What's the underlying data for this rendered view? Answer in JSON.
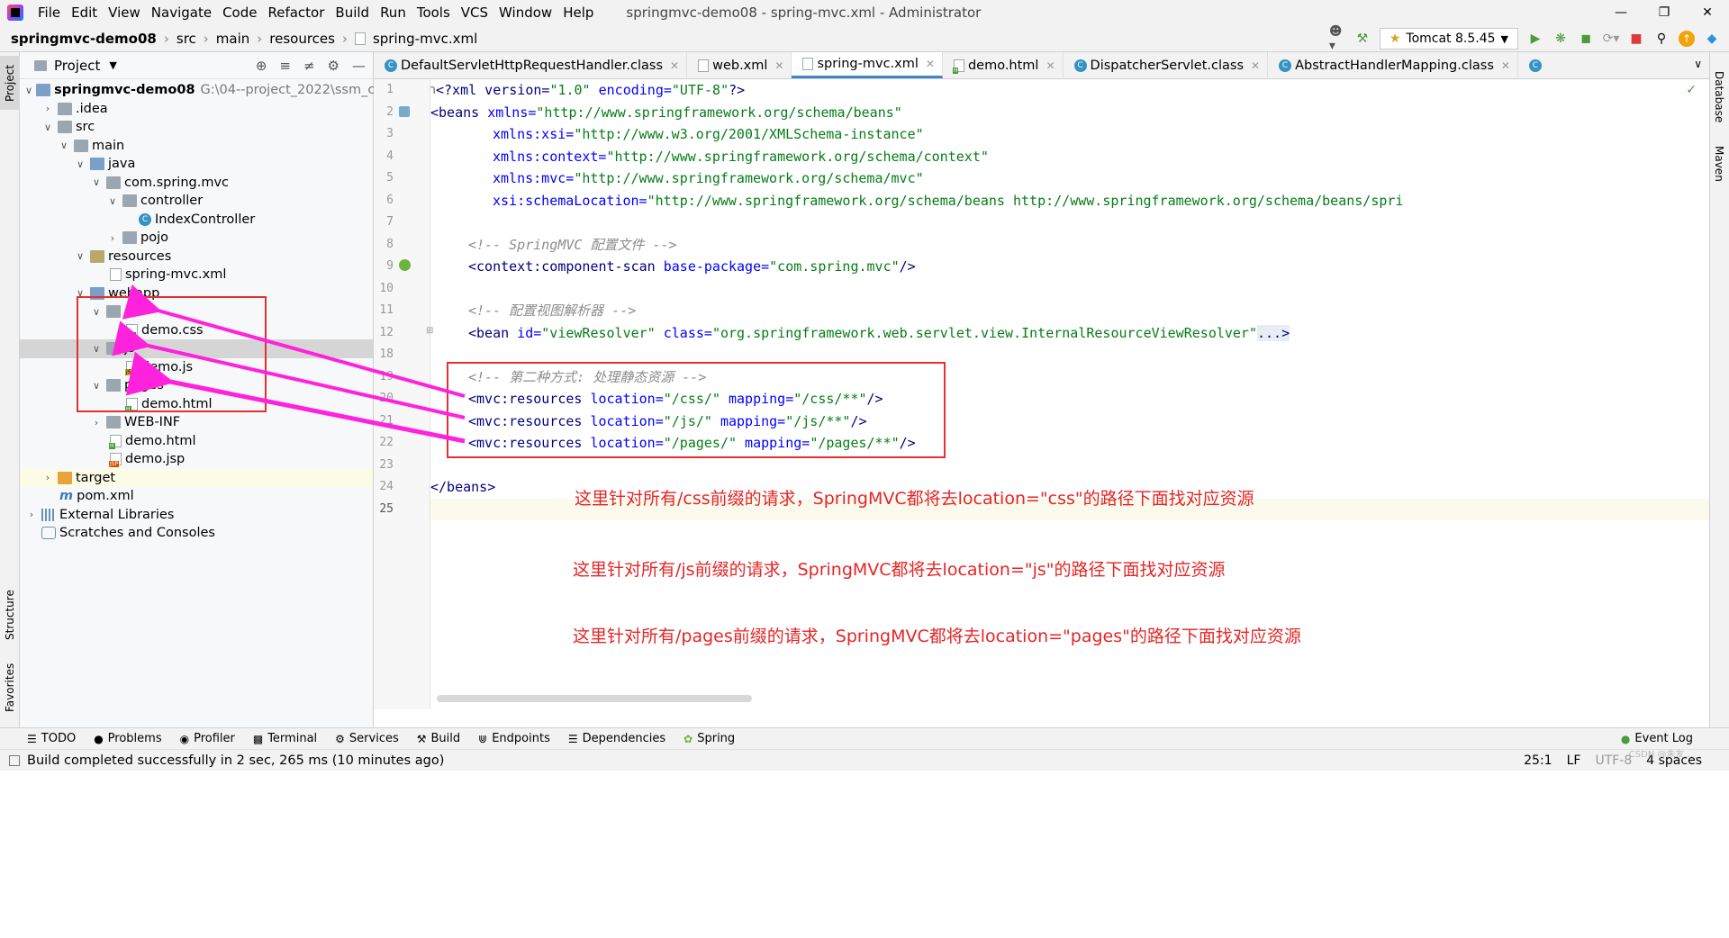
{
  "menubar": {
    "items": [
      "File",
      "Edit",
      "View",
      "Navigate",
      "Code",
      "Refactor",
      "Build",
      "Run",
      "Tools",
      "VCS",
      "Window",
      "Help"
    ],
    "window_title": "springmvc-demo08 - spring-mvc.xml - Administrator"
  },
  "navbar": {
    "crumbs": [
      "springmvc-demo08",
      "src",
      "main",
      "resources",
      "spring-mvc.xml"
    ],
    "run_config": "Tomcat 8.5.45"
  },
  "left_strip": {
    "project": "Project",
    "structure": "Structure",
    "favorites": "Favorites"
  },
  "right_strip": {
    "database": "Database",
    "maven": "Maven"
  },
  "project_panel": {
    "title": "Project",
    "tree": [
      {
        "label": "springmvc-demo08",
        "path": "G:\\04--project_2022\\ssm_code\\sprin",
        "bold": true
      },
      {
        "label": ".idea"
      },
      {
        "label": "src"
      },
      {
        "label": "main"
      },
      {
        "label": "java"
      },
      {
        "label": "com.spring.mvc"
      },
      {
        "label": "controller"
      },
      {
        "label": "IndexController"
      },
      {
        "label": "pojo"
      },
      {
        "label": "resources"
      },
      {
        "label": "spring-mvc.xml"
      },
      {
        "label": "webapp"
      },
      {
        "label": "css"
      },
      {
        "label": "demo.css"
      },
      {
        "label": "js"
      },
      {
        "label": "demo.js"
      },
      {
        "label": "pages"
      },
      {
        "label": "demo.html"
      },
      {
        "label": "WEB-INF"
      },
      {
        "label": "demo.html"
      },
      {
        "label": "demo.jsp"
      },
      {
        "label": "target"
      },
      {
        "label": "pom.xml"
      },
      {
        "label": "External Libraries"
      },
      {
        "label": "Scratches and Consoles"
      }
    ]
  },
  "editor_tabs": [
    "DefaultServletHttpRequestHandler.class",
    "web.xml",
    "spring-mvc.xml",
    "demo.html",
    "DispatcherServlet.class",
    "AbstractHandlerMapping.class"
  ],
  "line_numbers": [
    "1",
    "2",
    "3",
    "4",
    "5",
    "6",
    "7",
    "8",
    "9",
    "10",
    "11",
    "12",
    "18",
    "19",
    "20",
    "21",
    "22",
    "23",
    "24",
    "25"
  ],
  "code": {
    "l1a": "<?xml version=",
    "l1b": "\"1.0\"",
    "l1c": " encoding=",
    "l1d": "\"UTF-8\"",
    "l1e": "?>",
    "l2a": "<beans",
    " l2b": "",
    "l2attr": " xmlns=",
    "l2val": "\"http://www.springframework.org/schema/beans\"",
    "l3attr": "xmlns:xsi=",
    "l3val": "\"http://www.w3.org/2001/XMLSchema-instance\"",
    "l4attr": "xmlns:context=",
    "l4val": "\"http://www.springframework.org/schema/context\"",
    "l5attr": "xmlns:mvc=",
    "l5val": "\"http://www.springframework.org/schema/mvc\"",
    "l6attr": "xsi:schemaLocation=",
    "l6val": "\"http://www.springframework.org/schema/beans http://www.springframework.org/schema/beans/spri",
    "l8": "<!-- SpringMVC 配置文件 -->",
    "l9tag": "<context:component-scan",
    "l9attr": " base-package=",
    "l9val": "\"com.spring.mvc\"",
    "l9end": "/>",
    "l11": "<!-- 配置视图解析器 -->",
    "l12tag": "<bean",
    "l12attr1": " id=",
    "l12val1": "\"viewResolver\"",
    "l12attr2": " class=",
    "l12val2": "\"org.springframework.web.servlet.view.InternalResourceViewResolver\"",
    "l12end": "...>",
    "l19": "<!-- 第二种方式: 处理静态资源 -->",
    "l20tag": "<mvc:resources",
    "l20attr1": " location=",
    "l20val1": "\"/css/\"",
    "l20attr2": " mapping=",
    "l20val2": "\"/css/**\"",
    "l20end": "/>",
    "l21tag": "<mvc:resources",
    "l21attr1": " location=",
    "l21val1": "\"/js/\"",
    "l21attr2": " mapping=",
    "l21val2": "\"/js/**\"",
    "l21end": "/>",
    "l22tag": "<mvc:resources",
    "l22attr1": " location=",
    "l22val1": "\"/pages/\"",
    "l22attr2": " mapping=",
    "l22val2": "\"/pages/**\"",
    "l22end": "/>",
    "l24": "</beans>"
  },
  "notes": {
    "n1": "这里针对所有/css前缀的请求，SpringMVC都将去location=\"css\"的路径下面找对应资源",
    "n2": "这里针对所有/js前缀的请求，SpringMVC都将去location=\"js\"的路径下面找对应资源",
    "n3": "这里针对所有/pages前缀的请求，SpringMVC都将去location=\"pages\"的路径下面找对应资源"
  },
  "tool_windows": [
    "TODO",
    "Problems",
    "Profiler",
    "Terminal",
    "Services",
    "Build",
    "Endpoints",
    "Dependencies",
    "Spring"
  ],
  "event_log": "Event Log",
  "status": {
    "message": "Build completed successfully in 2 sec, 265 ms (10 minutes ago)",
    "position": "25:1",
    "line_sep": "LF",
    "encoding": "UTF-8",
    "indent": "4 spaces",
    "watermark": "CSDN @朱友..."
  },
  "colors": {
    "annotation": "#e53030",
    "arrow": "#ff22dd",
    "active_tab": "#4083c9"
  }
}
